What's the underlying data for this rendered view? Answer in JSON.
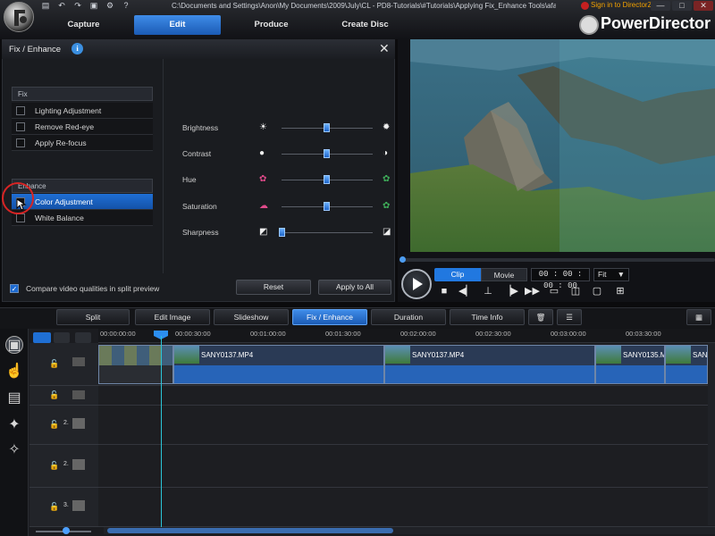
{
  "window": {
    "title": "C:\\Documents and Settings\\Anon\\My Documents\\2009\\July\\CL - PD8-Tutorials\\#Tutorials\\Applying Fix_Enhance Tools\\afae...",
    "sign_in": "Sign in to DirectorZone",
    "brand": "PowerDirector",
    "minimize": "—",
    "maximize": "□",
    "close": "✕"
  },
  "main_tabs": [
    "Capture",
    "Edit",
    "Produce",
    "Create Disc"
  ],
  "active_tab": "Edit",
  "panel": {
    "title": "Fix / Enhance",
    "info": "i",
    "close": "✕",
    "fix_header": "Fix",
    "fix_items": [
      "Lighting Adjustment",
      "Remove Red-eye",
      "Apply Re-focus"
    ],
    "enhance_header": "Enhance",
    "enhance_items": [
      "Color Adjustment",
      "White Balance"
    ],
    "selected_enhance": "Color Adjustment",
    "sliders": [
      {
        "label": "Brightness",
        "value": 0.5
      },
      {
        "label": "Contrast",
        "value": 0.5
      },
      {
        "label": "Hue",
        "value": 0.5
      },
      {
        "label": "Saturation",
        "value": 0.5
      },
      {
        "label": "Sharpness",
        "value": 0.0
      }
    ],
    "compare_label": "Compare video qualities in split preview",
    "compare_checked": true,
    "reset_label": "Reset",
    "apply_all_label": "Apply to All"
  },
  "preview": {
    "clip_label": "Clip",
    "movie_label": "Movie",
    "timecode": "00 : 00 : 00 : 00",
    "fit_value": "Fit"
  },
  "toolbar": {
    "buttons": [
      "Split",
      "Edit Image",
      "Slideshow",
      "Fix / Enhance",
      "Duration",
      "Time Info"
    ],
    "active": "Fix / Enhance"
  },
  "timeline": {
    "ruler": [
      "00:00:00:00",
      "00:00:30:00",
      "00:01:00:00",
      "00:01:30:00",
      "00:02:00:00",
      "00:02:30:00",
      "00:03:00:00",
      "00:03:30:00"
    ],
    "clips": [
      "SANY0137.MP4",
      "SANY0137.MP4",
      "SANY0135.M",
      "SANY"
    ],
    "track_numbers": [
      "2.",
      "2.",
      "3."
    ]
  },
  "colors": {
    "accent": "#1f6fd4",
    "playhead": "#2bc6d8",
    "annotation": "#d82424",
    "signin": "#f2a100"
  }
}
